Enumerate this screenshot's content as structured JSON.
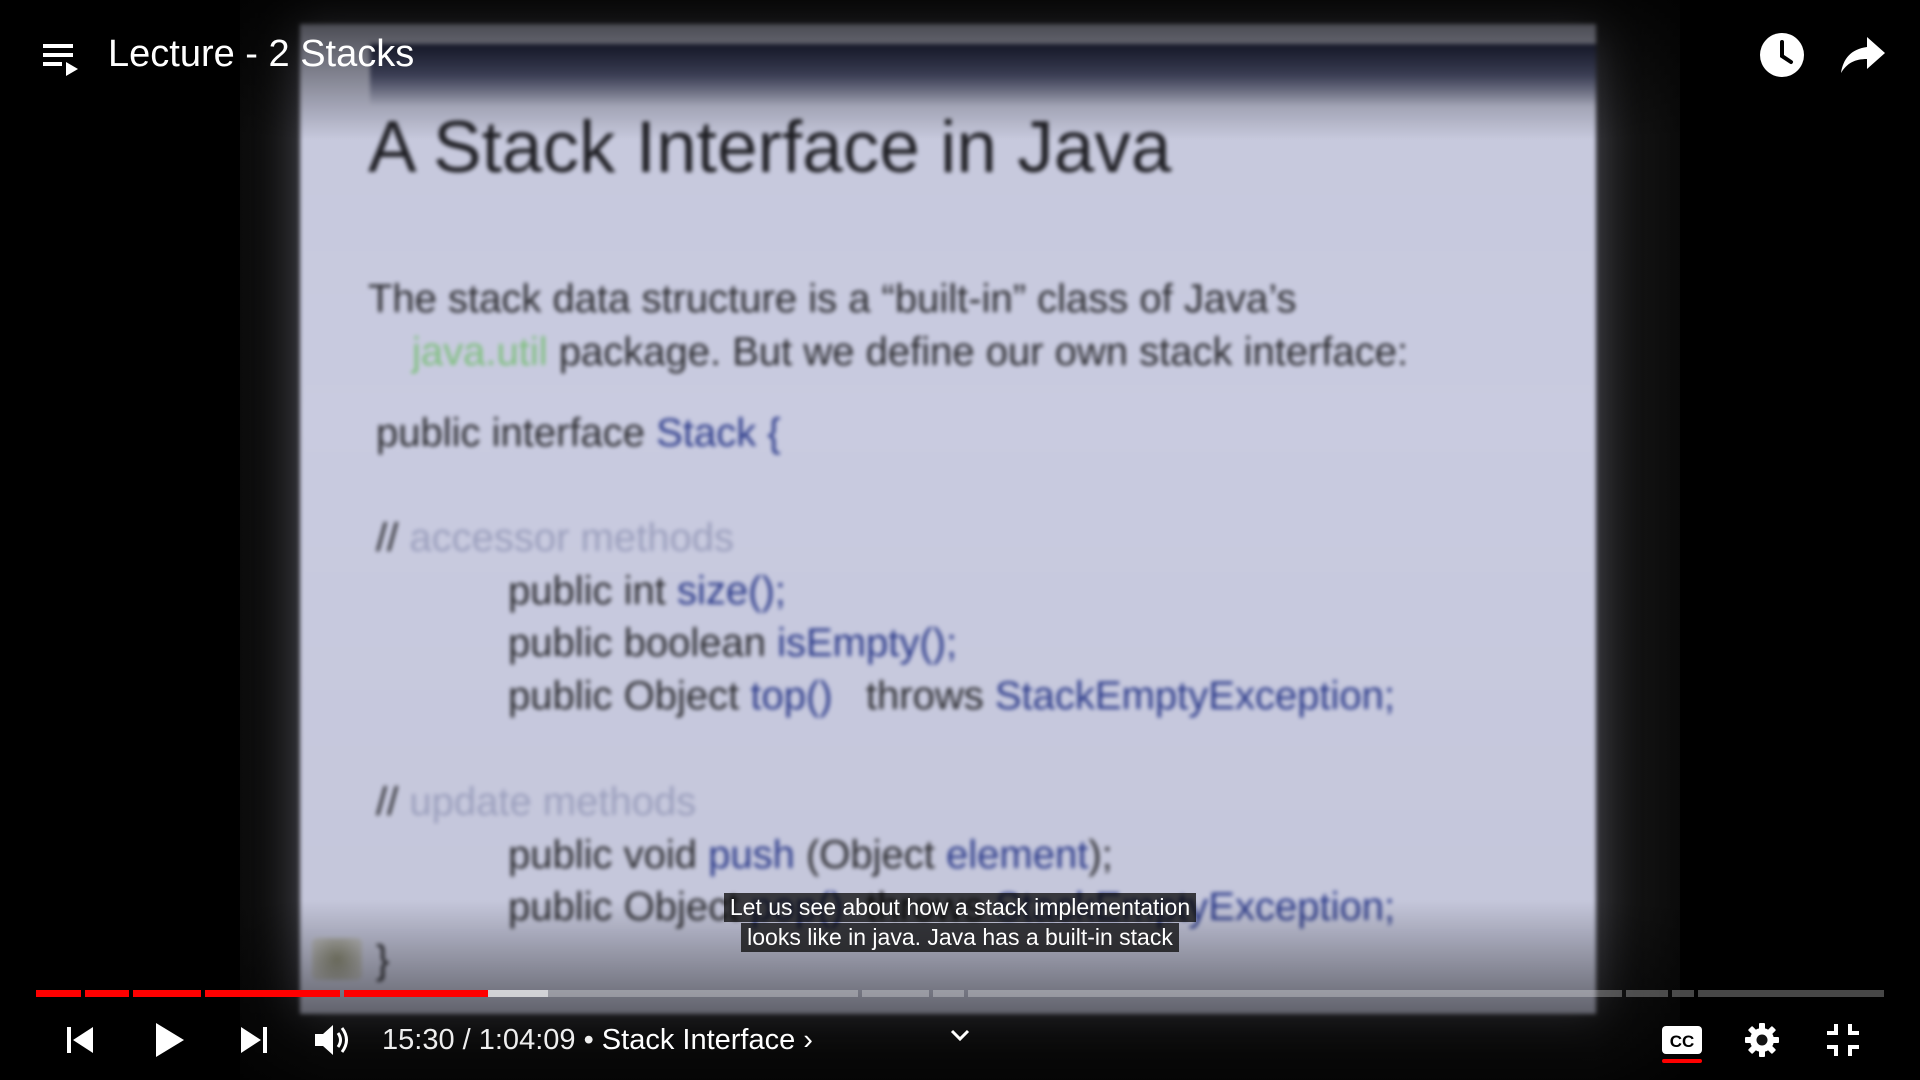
{
  "header": {
    "title": "Lecture - 2 Stacks",
    "icons": [
      "playlist-icon",
      "watch-later-icon",
      "share-icon"
    ]
  },
  "slide": {
    "title": "A Stack Interface in Java",
    "intro_line1": "The stack data structure is a “built-in” class of Java’s",
    "intro_pkg": "java.util",
    "intro_line2": " package. But we define our own stack interface:",
    "decl_kw": "public interface ",
    "decl_name": "Stack {",
    "comment1_slash": "//",
    "comment1_text": " accessor methods",
    "m1_kw": "public int ",
    "m1_name": "size();",
    "m2_kw": "public boolean ",
    "m2_name": "isEmpty();",
    "m3_kw": "public Object ",
    "m3_name": "top()",
    "m3_throws": "   throws ",
    "m3_exc": "StackEmptyException;",
    "comment2_slash": "//",
    "comment2_text": " update methods",
    "m4_kw": "public void ",
    "m4_name": "push",
    "m4_arg_open": " (Object ",
    "m4_arg": "element",
    "m4_close": ");",
    "m5_kw": "public Object ",
    "m5_name": "pop()",
    "m5_throws": "  throws ",
    "m5_exc": "StackEmptyException;",
    "close": "}"
  },
  "captions": {
    "line1": "Let us see about how a stack implementation",
    "line2": "looks like in java. Java has a built-in stack"
  },
  "controls": {
    "current_time": "15:30",
    "separator": " / ",
    "duration": "1:04:09",
    "chapter_bullet": " • ",
    "chapter": "Stack Interface",
    "chapter_arrow": "›",
    "played_fraction": 0.242,
    "icons": [
      "previous-icon",
      "play-icon",
      "next-icon",
      "volume-icon",
      "expand-chapters-icon",
      "captions-icon",
      "settings-icon",
      "exit-fullscreen-icon"
    ],
    "accent_color": "#ff0000"
  }
}
